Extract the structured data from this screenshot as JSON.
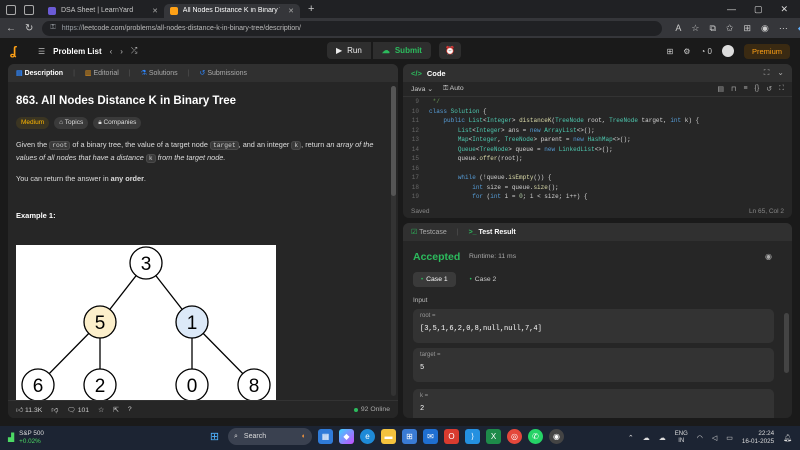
{
  "browser": {
    "tabs": [
      {
        "label": "DSA Sheet | LearnYard",
        "active": false,
        "fav_color": "#6b5bd6"
      },
      {
        "label": "All Nodes Distance K in Binary Tre",
        "active": true,
        "fav_color": "#ffa116"
      }
    ],
    "url_prefix": "https://",
    "url": "leetcode.com/problems/all-nodes-distance-k-in-binary-tree/description/"
  },
  "nav": {
    "problem_list": "Problem List",
    "run": "Run",
    "submit": "Submit",
    "streak": "0",
    "premium": "Premium"
  },
  "left": {
    "tabs": [
      "Description",
      "Editorial",
      "Solutions",
      "Submissions"
    ],
    "title": "863. All Nodes Distance K in Binary Tree",
    "difficulty": "Medium",
    "topics": "Topics",
    "companies": "Companies",
    "desc_1": "Given the",
    "desc_code_root": "root",
    "desc_2": "of a binary tree, the value of a target node",
    "desc_code_target": "target",
    "desc_3": ", and an integer",
    "desc_code_k": "k",
    "desc_4": ", return",
    "desc_5": "an array of the values of all nodes that have a distance",
    "desc_code_k2": "k",
    "desc_6": "from the target node.",
    "p2_a": "You can return the answer in",
    "p2_b": "any order",
    "p2_c": ".",
    "example_label": "Example 1:",
    "tree_nodes": [
      {
        "label": "3",
        "color": "#ffffff"
      },
      {
        "label": "5",
        "color": "#fcefcb"
      },
      {
        "label": "1",
        "color": "#dce9f8"
      },
      {
        "label": "6",
        "color": "#ffffff"
      },
      {
        "label": "2",
        "color": "#ffffff"
      },
      {
        "label": "0",
        "color": "#ffffff"
      },
      {
        "label": "8",
        "color": "#ffffff"
      }
    ],
    "likes": "11.3K",
    "comments": "101",
    "online": "92 Online"
  },
  "code": {
    "title": "Code",
    "language": "Java",
    "mode": "Auto",
    "saved": "Saved",
    "cursor": "Ln 65, Col 2",
    "lines": [
      {
        "n": "9",
        "html": "<span class='cm'> */</span>"
      },
      {
        "n": "10",
        "html": "<span class='kw'>class</span> <span class='ty'>Solution</span> {"
      },
      {
        "n": "11",
        "html": "    <span class='kw'>public</span> <span class='ty'>List</span>&lt;<span class='ty'>Integer</span>&gt; <span class='fn'>distanceK</span>(<span class='ty'>TreeNode</span> root, <span class='ty'>TreeNode</span> target, <span class='kw'>int</span> k) {"
      },
      {
        "n": "12",
        "html": "        <span class='ty'>List</span>&lt;<span class='ty'>Integer</span>&gt; ans = <span class='kw'>new</span> <span class='ty'>ArrayList</span>&lt;&gt;();"
      },
      {
        "n": "13",
        "html": "        <span class='ty'>Map</span>&lt;<span class='ty'>Integer</span>, <span class='ty'>TreeNode</span>&gt; parent = <span class='kw'>new</span> <span class='ty'>HashMap</span>&lt;&gt;();"
      },
      {
        "n": "14",
        "html": "        <span class='ty'>Queue</span>&lt;<span class='ty'>TreeNode</span>&gt; queue = <span class='kw'>new</span> <span class='ty'>LinkedList</span>&lt;&gt;();"
      },
      {
        "n": "15",
        "html": "        queue.<span class='fn'>offer</span>(root);"
      },
      {
        "n": "16",
        "html": ""
      },
      {
        "n": "17",
        "html": "        <span class='kw'>while</span> (!queue.<span class='fn'>isEmpty</span>()) {"
      },
      {
        "n": "18",
        "html": "            <span class='kw'>int</span> size = queue.<span class='fn'>size</span>();"
      },
      {
        "n": "19",
        "html": "            <span class='kw'>for</span> (<span class='kw'>int</span> i = <span class='nm'>0</span>; i &lt; size; i++) {"
      }
    ]
  },
  "test": {
    "tab_testcase": "Testcase",
    "tab_result": "Test Result",
    "status": "Accepted",
    "runtime": "Runtime: 11 ms",
    "cases": [
      "Case 1",
      "Case 2"
    ],
    "input_label": "Input",
    "fields": [
      {
        "name": "root =",
        "value": "[3,5,1,6,2,0,8,null,null,7,4]"
      },
      {
        "name": "target =",
        "value": "5"
      },
      {
        "name": "k =",
        "value": "2"
      }
    ]
  },
  "taskbar": {
    "stock_name": "S&P 500",
    "stock_change": "+0.02%",
    "search": "Search",
    "lang_1": "ENG",
    "lang_2": "IN",
    "time": "22:24",
    "date": "16-01-2025"
  }
}
